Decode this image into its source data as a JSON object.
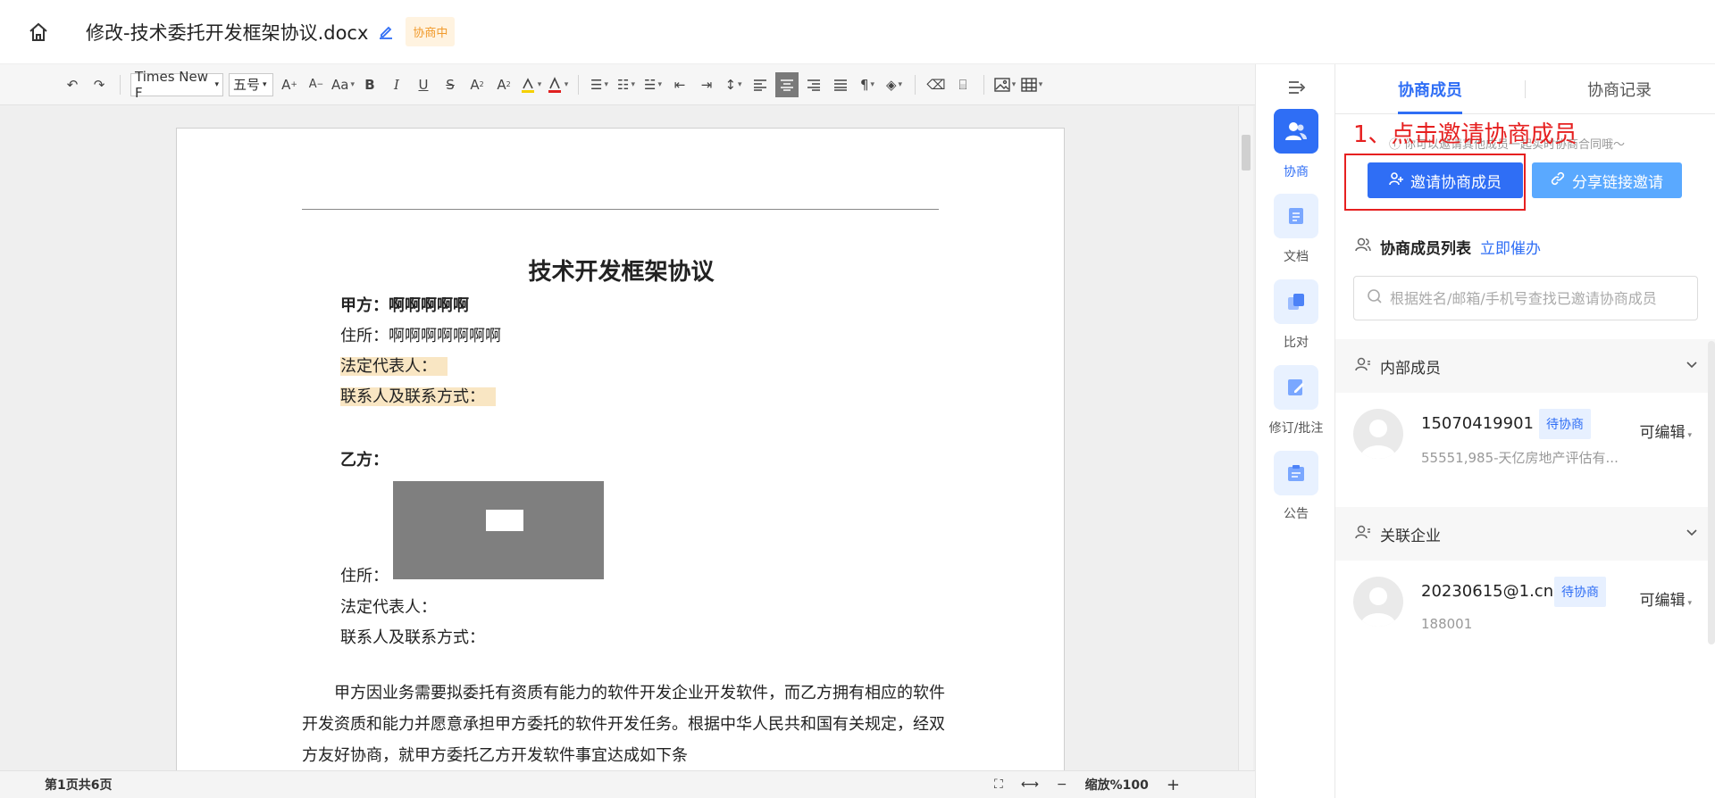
{
  "header": {
    "title": "修改-技术委托开发框架协议.docx",
    "badge": "协商中"
  },
  "toolbar": {
    "font_family": "Times New F",
    "font_size": "五号",
    "font_size_caret": "▾",
    "grow": "A",
    "shrink": "A",
    "case": "Aa",
    "bold": "B",
    "italic": "I",
    "underline": "U",
    "strike": "S",
    "superscript": "A",
    "subscript": "A",
    "pilcrow": "¶"
  },
  "document": {
    "title": "技术开发框架协议",
    "party_a_label": "甲方：啊啊啊啊啊",
    "address_a": "住所：啊啊啊啊啊啊啊",
    "legal_rep_a": "法定代表人：",
    "contact_a": "联系人及联系方式：",
    "party_b_label": "乙方：",
    "address_b": "住所：",
    "legal_rep_b": "法定代表人：",
    "contact_b": "联系人及联系方式：",
    "paragraph": "甲方因业务需要拟委托有资质有能力的软件开发企业开发软件，而乙方拥有相应的软件开发资质和能力并愿意承担甲方委托的软件开发任务。根据中华人民共和国有关规定，经双方友好协商，就甲方委托乙方开发软件事宜达成如下条"
  },
  "status": {
    "page_info": "第1页共6页",
    "zoom": "缩放%100"
  },
  "rail": {
    "items": [
      {
        "label": "协商"
      },
      {
        "label": "文档"
      },
      {
        "label": "比对"
      },
      {
        "label": "修订/批注"
      },
      {
        "label": "公告"
      }
    ]
  },
  "panel": {
    "tabs": [
      {
        "label": "协商成员"
      },
      {
        "label": "协商记录"
      }
    ],
    "hint": "你可以邀请其他成员一起实时协商合同哦～",
    "annotation": "1、点击邀请协商成员",
    "invite_button": "邀请协商成员",
    "share_button": "分享链接邀请",
    "list_title": "协商成员列表",
    "urge_link": "立即催办",
    "search_placeholder": "根据姓名/邮箱/手机号查找已邀请协商成员",
    "groups": [
      {
        "title": "内部成员",
        "member": {
          "name": "15070419901",
          "status": "待协商",
          "sub": "55551,985-天亿房地产评估有...",
          "permission": "可编辑"
        }
      },
      {
        "title": "关联企业",
        "member": {
          "name": "20230615@1.cn",
          "status": "待协商",
          "sub": "188001",
          "permission": "可编辑"
        }
      }
    ]
  },
  "colors": {
    "accent": "#2f6ef5",
    "share": "#5aa9ff",
    "annotation": "#e62020",
    "badge": "#f19a2b"
  }
}
